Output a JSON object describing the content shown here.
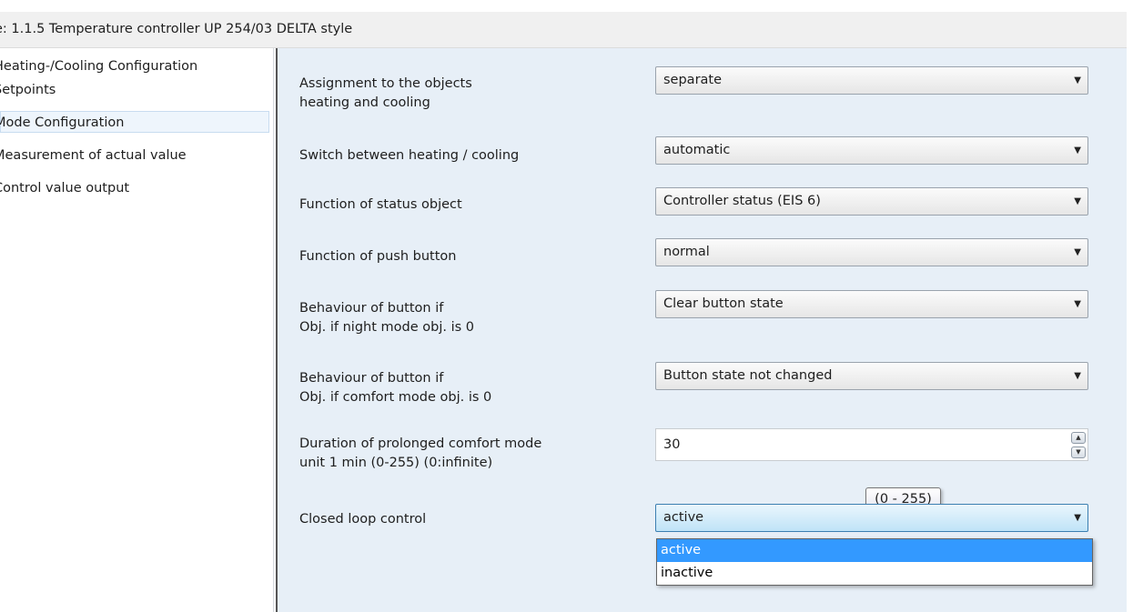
{
  "window": {
    "title": "e: 1.1.5  Temperature controller UP 254/03 DELTA style"
  },
  "nav": {
    "items": [
      {
        "label": "Heating-/Cooling  Configuration",
        "selected": false
      },
      {
        "label": "Setpoints",
        "selected": false
      },
      {
        "label": "Mode  Configuration",
        "selected": true
      },
      {
        "label": "Measurement of actual value",
        "selected": false
      },
      {
        "label": "Control value output",
        "selected": false
      }
    ]
  },
  "params": {
    "assignment": {
      "label": "Assignment to the objects\nheating and cooling",
      "value": "separate"
    },
    "switch_mode": {
      "label": "Switch between heating / cooling",
      "value": "automatic"
    },
    "status_object": {
      "label": "Function of status object",
      "value": "Controller status (EIS 6)"
    },
    "push_button": {
      "label": "Function of push button",
      "value": "normal"
    },
    "night_behaviour": {
      "label": "Behaviour of button if\n Obj. if night mode obj. is 0",
      "value": "Clear button state"
    },
    "comfort_behaviour": {
      "label": "Behaviour of button if\n Obj. if comfort mode obj. is 0",
      "value": "Button state not changed"
    },
    "duration": {
      "label": "Duration of prolonged comfort mode\nunit 1 min  (0-255)  (0:infinite)",
      "value": "30",
      "tooltip": "(0 - 255)"
    },
    "closed_loop": {
      "label": "Closed loop control",
      "value": "active",
      "options": [
        "active",
        "inactive"
      ],
      "highlighted_option": "active"
    }
  },
  "icons": {
    "dropdown_arrow": "▼",
    "spin_up": "▲",
    "spin_down": "▼"
  },
  "colors": {
    "panel_background": "#e7eff7",
    "selection_highlight": "#3399ff"
  }
}
